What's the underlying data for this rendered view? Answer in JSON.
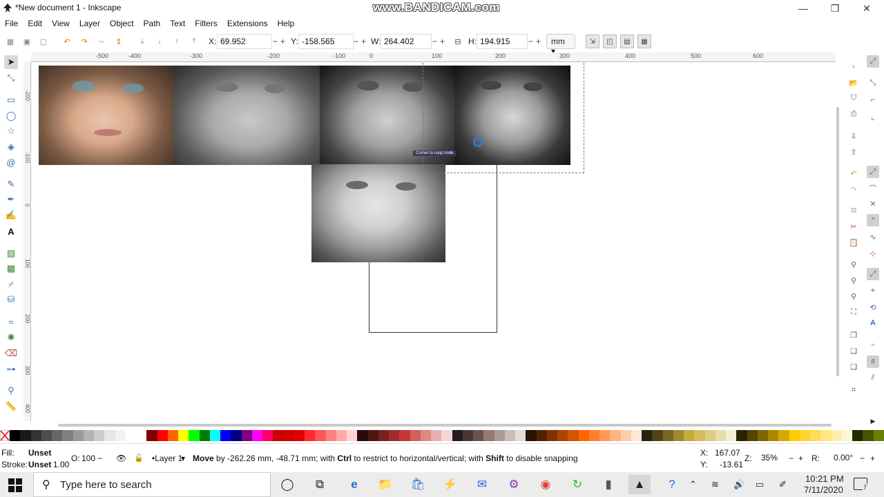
{
  "window": {
    "title": "*New document 1 - Inkscape",
    "watermark": "www.BANDICAM.com",
    "minimize": "—",
    "maximize": "❐",
    "close": "✕"
  },
  "menu": [
    "File",
    "Edit",
    "View",
    "Layer",
    "Object",
    "Path",
    "Text",
    "Filters",
    "Extensions",
    "Help"
  ],
  "toolbar": {
    "x_label": "X:",
    "x_value": "69.952",
    "y_label": "Y:",
    "y_value": "-158.565",
    "w_label": "W:",
    "w_value": "264.402",
    "h_label": "H:",
    "h_value": "194.915",
    "minus": "−",
    "plus": "+",
    "unit": "mm",
    "unit_caret": "▾",
    "lock_icon": "🔒"
  },
  "ruler": {
    "h": [
      "-500",
      "-400",
      "-300",
      "-200",
      "-100",
      "0",
      "100",
      "200",
      "300",
      "400",
      "500",
      "600"
    ],
    "v": [
      "-200",
      "-100",
      "0",
      "100",
      "200",
      "300",
      "400"
    ]
  },
  "canvas": {
    "tooltip": "Corner to cusp node"
  },
  "status": {
    "fill_label": "Fill:",
    "fill_value": "Unset",
    "stroke_label": "Stroke:",
    "stroke_value": "Unset",
    "stroke_width": "1.00",
    "opacity_label": "O:",
    "opacity_value": "100",
    "opacity_caret": "−",
    "layer": "•Layer 1",
    "layer_caret": "▾",
    "message_bold": "Move",
    "message_1": " by -262.26 mm, -48.71 mm; with ",
    "message_ctrl": "Ctrl",
    "message_2": " to restrict to horizontal/vertical; with ",
    "message_shift": "Shift",
    "message_3": " to disable snapping",
    "cx_label": "X:",
    "cx_value": "167.07",
    "cy_label": "Y:",
    "cy_value": "-13.61",
    "zoom_label": "Z:",
    "zoom_value": "35%",
    "rot_label": "R:",
    "rot_value": "0.00°"
  },
  "taskbar": {
    "search_placeholder": "Type here to search",
    "time": "10:21 PM",
    "date": "7/11/2020",
    "notif_count": "7"
  },
  "palette": [
    "#000000",
    "#1a1a1a",
    "#333333",
    "#4d4d4d",
    "#666666",
    "#808080",
    "#999999",
    "#b3b3b3",
    "#cccccc",
    "#e6e6e6",
    "#f2f2f2",
    "#ffffff",
    "#ffffff",
    "#800000",
    "#ff0000",
    "#ff6600",
    "#ffff00",
    "#00ff00",
    "#008000",
    "#00ffff",
    "#0000ff",
    "#000080",
    "#800080",
    "#ff00ff",
    "#ff0066",
    "#cc0000",
    "#d40000",
    "#e00000",
    "#ff2a2a",
    "#ff5555",
    "#ff8080",
    "#ffaaaa",
    "#ffd5d5",
    "#280b0b",
    "#501616",
    "#782121",
    "#a02c2c",
    "#c83737",
    "#d35f5f",
    "#de8787",
    "#e9afaf",
    "#f4d7d7",
    "#241c1c",
    "#483737",
    "#6c5353",
    "#917c6f",
    "#ac9d93",
    "#c8beb7",
    "#e3dedb",
    "#2b1100",
    "#552200",
    "#803300",
    "#aa4400",
    "#d45500",
    "#ff6600",
    "#ff7f2a",
    "#ff9955",
    "#ffb380",
    "#ffccaa",
    "#ffe6d5",
    "#28220b",
    "#504416",
    "#786721",
    "#a0892c",
    "#c8ab37",
    "#d4bd5f",
    "#decd87",
    "#e9ddaf",
    "#f4eed7",
    "#2b2200",
    "#554400",
    "#806600",
    "#aa8800",
    "#d4aa00",
    "#ffcc00",
    "#ffd42a",
    "#ffdd55",
    "#ffe680",
    "#ffeeaa",
    "#fff6d5",
    "#222b00",
    "#445500",
    "#668000"
  ]
}
